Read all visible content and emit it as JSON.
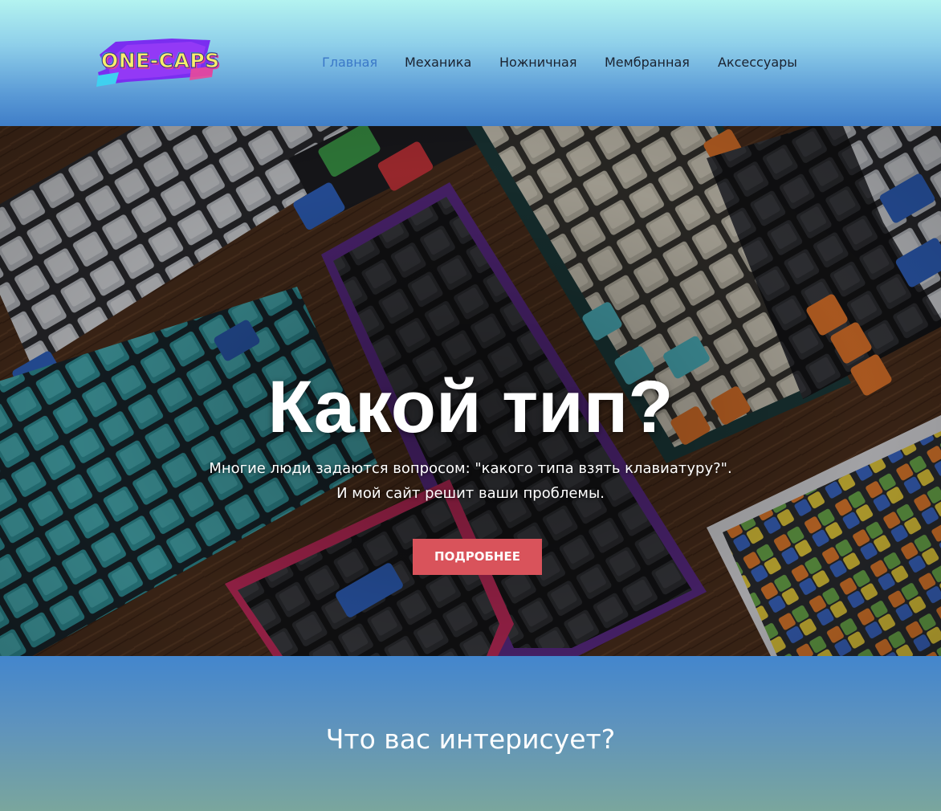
{
  "header": {
    "logo_text": "ONE-CAPS",
    "nav": [
      {
        "label": "Главная",
        "active": true
      },
      {
        "label": "Механика",
        "active": false
      },
      {
        "label": "Ножничная",
        "active": false
      },
      {
        "label": "Мембранная",
        "active": false
      },
      {
        "label": "Аксессуары",
        "active": false
      }
    ]
  },
  "hero": {
    "title": "Какой тип?",
    "subtitle_line1": "Многие люди задаются вопросом: \"какого типа взять клавиатуру?\".",
    "subtitle_line2": "И мой сайт решит ваши проблемы.",
    "button_label": "ПОДРОБНЕЕ",
    "background_image": "keyboards-photo"
  },
  "section": {
    "title": "Что вас интерисует?"
  },
  "colors": {
    "nav_active": "#3a78c8",
    "nav_text": "#1a2230",
    "button_bg": "#d9535b",
    "header_top": "#b3f3f0",
    "header_bottom": "#3f7ec8"
  }
}
